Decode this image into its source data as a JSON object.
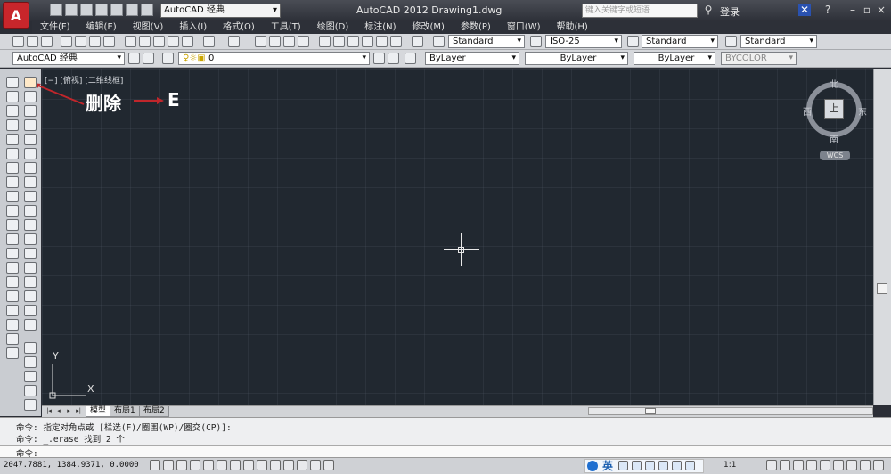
{
  "window": {
    "app_button_letter": "A",
    "workspace": "AutoCAD 经典",
    "title": "AutoCAD 2012    Drawing1.dwg",
    "search_placeholder": "键入关键字或短语",
    "login": "登录"
  },
  "menu": [
    "文件(F)",
    "编辑(E)",
    "视图(V)",
    "插入(I)",
    "格式(O)",
    "工具(T)",
    "绘图(D)",
    "标注(N)",
    "修改(M)",
    "参数(P)",
    "窗口(W)",
    "帮助(H)"
  ],
  "toolbar1": {
    "text_style": "Standard",
    "dim_style": "ISO-25",
    "table_style": "Standard",
    "multileader_style": "Standard"
  },
  "toolbar2": {
    "workspace_select": "AutoCAD 经典",
    "layer": "0",
    "color": "ByLayer",
    "linetype": "ByLayer",
    "lineweight": "ByLayer",
    "plotstyle": "BYCOLOR"
  },
  "viewport_label": "[−] [俯视] [二维线框]",
  "annotation": {
    "command": "删除",
    "arrow": "⟵",
    "key": "E"
  },
  "viewcube": {
    "north": "北",
    "south": "南",
    "east": "东",
    "west": "西",
    "top_face": "上",
    "wcs": "WCS"
  },
  "ucs": {
    "x": "X",
    "y": "Y"
  },
  "tabs": [
    "模型",
    "布局1",
    "布局2"
  ],
  "command_history": [
    "命令: 指定对角点或 [栏选(F)/圈围(WP)/圈交(CP)]:",
    "命令: _.erase 找到 2 个"
  ],
  "command_prompt": "命令:",
  "status": {
    "coordinates": "2047.7881, 1384.9371, 0.0000",
    "ime_lang": "英",
    "scale": "1:1"
  }
}
